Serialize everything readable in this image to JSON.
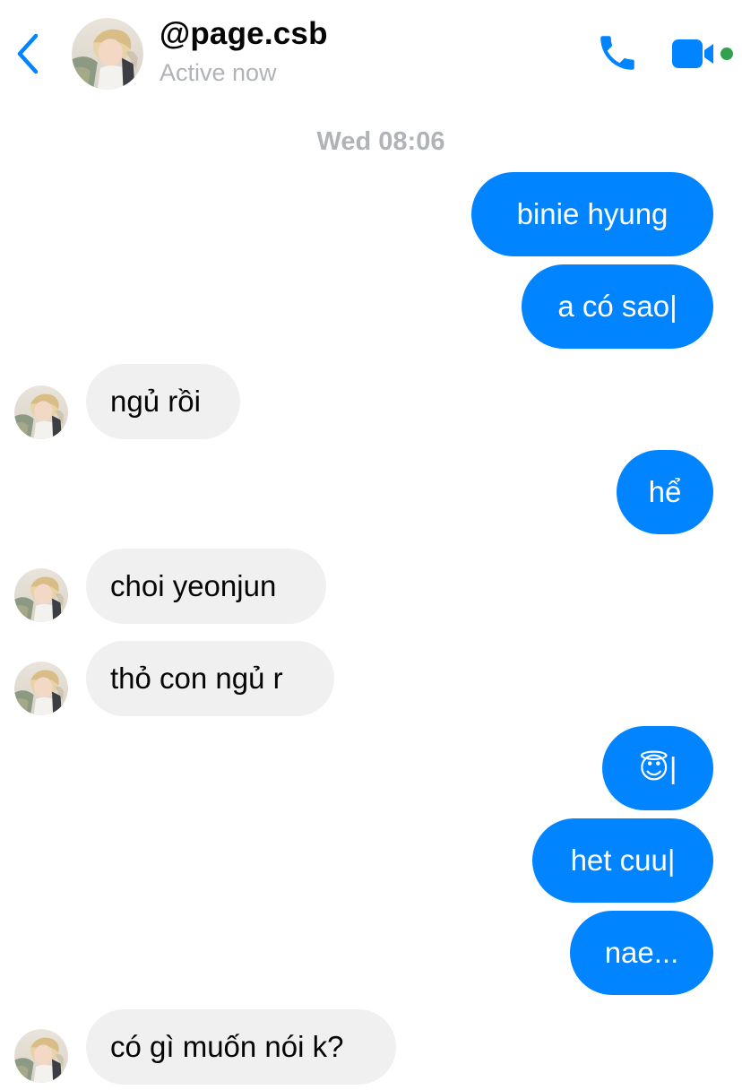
{
  "header": {
    "title": "@page.csb",
    "status": "Active now",
    "accent_color": "#0084ff",
    "online_color": "#31a24c",
    "icons": [
      "chevron-left-icon",
      "avatar",
      "phone-icon",
      "video-camera-icon"
    ]
  },
  "timestamp": "Wed 08:06",
  "messages": [
    {
      "sender": "me",
      "text": "binie hyung"
    },
    {
      "sender": "me",
      "text": "a có sao|"
    },
    {
      "sender": "them",
      "text": "ngủ rồi"
    },
    {
      "sender": "me",
      "text": "hể"
    },
    {
      "sender": "them",
      "text": "choi yeonjun"
    },
    {
      "sender": "them",
      "text": "thỏ con ngủ r"
    },
    {
      "sender": "me",
      "text": "😇|"
    },
    {
      "sender": "me",
      "text": "het cuu|"
    },
    {
      "sender": "me",
      "text": "nae..."
    },
    {
      "sender": "them",
      "text": "có gì muốn nói k?"
    }
  ],
  "colors": {
    "outgoing_bubble": "#0084ff",
    "incoming_bubble": "#f0f0f0",
    "muted_text": "#b0b3b8"
  }
}
